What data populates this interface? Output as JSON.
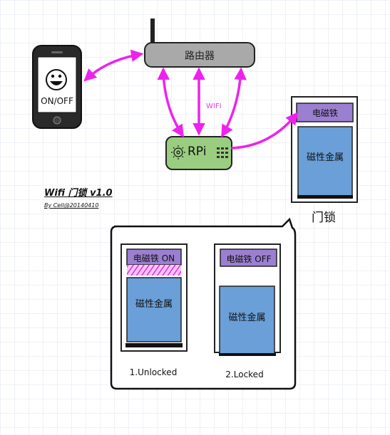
{
  "router": {
    "label": "路由器"
  },
  "phone": {
    "label": "ON/OFF",
    "icon": "smiley-face-icon"
  },
  "link": {
    "wifi_label": "WIFI"
  },
  "rpi": {
    "label": "RPi",
    "icon": "raspberry-logo-icon"
  },
  "door": {
    "magnet_label": "电磁铁",
    "metal_label": "磁性金属",
    "caption": "门锁"
  },
  "title": "Wifi 门锁 v1.0",
  "author": "By Cell@20140410",
  "states": [
    {
      "magnet_label": "电磁铁 ON",
      "metal_label": "磁性金属",
      "caption": "1.Unlocked"
    },
    {
      "magnet_label": "电磁铁 OFF",
      "metal_label": "磁性金属",
      "caption": "2.Locked"
    }
  ],
  "colors": {
    "connector": "#ee22ee",
    "router_fill": "#a9a9a9",
    "rpi_fill": "#9acd80",
    "magnet_fill": "#9b7fd0",
    "metal_fill": "#6a9fd8",
    "outline": "#222222"
  }
}
